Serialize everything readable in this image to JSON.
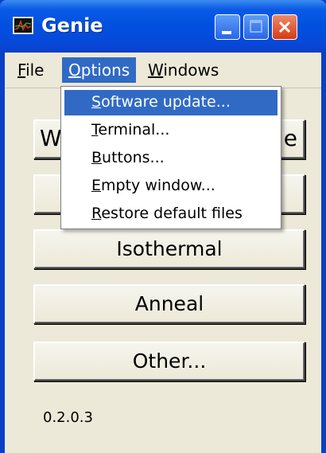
{
  "window": {
    "title": "Genie",
    "app_icon": "oscilloscope-icon",
    "controls": {
      "minimize": "minimize-icon",
      "maximize": "maximize-icon",
      "close": "close-icon"
    }
  },
  "menubar": {
    "file": {
      "ul": "F",
      "rest": "ile"
    },
    "options": {
      "ul": "",
      "pre": "",
      "text": "Options",
      "ul_char": "O"
    },
    "windows": {
      "ul": "W",
      "rest": "indows"
    }
  },
  "options_menu": {
    "items": [
      {
        "ul": "S",
        "rest": "oftware update...",
        "selected": true
      },
      {
        "ul": "T",
        "rest": "erminal...",
        "selected": false
      },
      {
        "ul": "B",
        "rest": "uttons...",
        "selected": false
      },
      {
        "ul": "E",
        "rest": "mpty window...",
        "selected": false
      },
      {
        "ul": "R",
        "rest": "estore default files",
        "selected": false
      }
    ]
  },
  "buttons": {
    "welcome_left": "W",
    "welcome_right": "e",
    "isothermal": "Isothermal",
    "anneal": "Anneal",
    "other": "Other..."
  },
  "version": "0.2.0.3",
  "colors": {
    "title_blue": "#0050e0",
    "menu_highlight": "#316ac5",
    "face": "#ece9d8",
    "close_red": "#d63a12"
  }
}
